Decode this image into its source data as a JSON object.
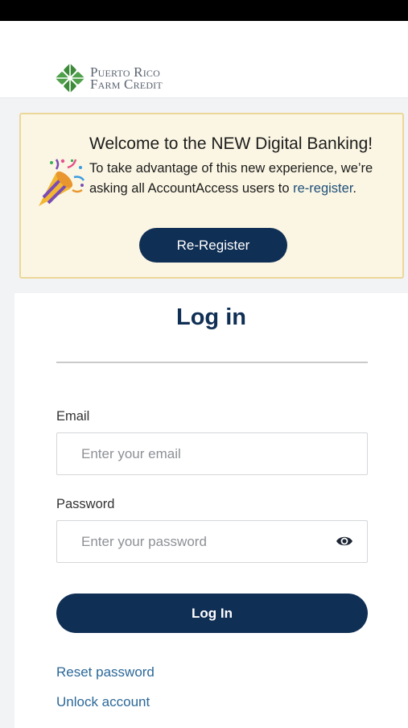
{
  "header": {
    "logo_line1": "Puerto Rico",
    "logo_line2": "Farm Credit"
  },
  "banner": {
    "title": "Welcome to the NEW Digital Banking!",
    "body_text": "To take advantage of this new experience, we’re asking all AccountAccess users to ",
    "body_link": "re-register",
    "body_end": ".",
    "button_label": "Re-Register",
    "icon": "party-popper-icon"
  },
  "login": {
    "title": "Log in",
    "email_label": "Email",
    "email_placeholder": "Enter your email",
    "email_value": "",
    "password_label": "Password",
    "password_placeholder": "Enter your password",
    "password_value": "",
    "password_toggle_icon": "eye-icon",
    "submit_label": "Log In",
    "reset_link": "Reset password",
    "unlock_link": "Unlock account"
  },
  "colors": {
    "brand_navy": "#102f55",
    "link_blue": "#2b6898",
    "banner_bg": "#fbf6e3",
    "banner_border": "#ecd79a",
    "logo_green": "#3d8b3a"
  }
}
